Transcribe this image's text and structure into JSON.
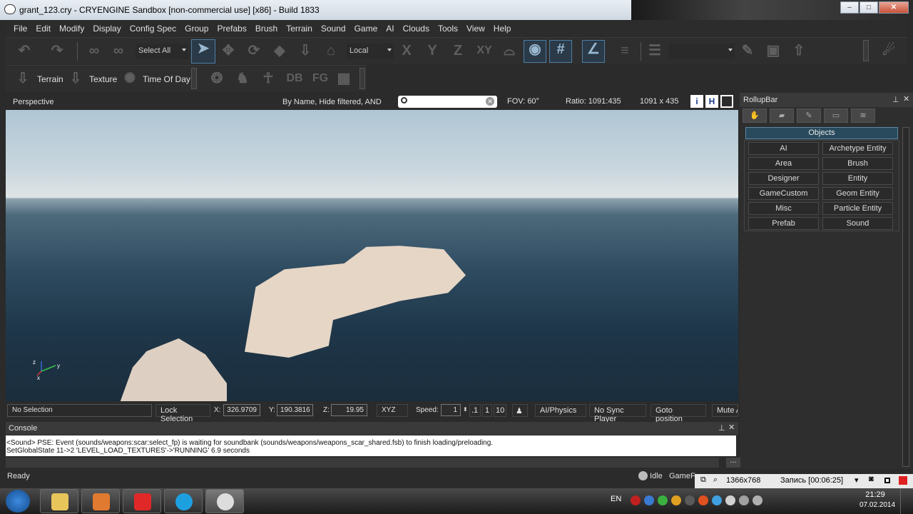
{
  "window": {
    "title": "grant_123.cry - CRYENGINE Sandbox [non-commercial use] [x86] - Build 1833",
    "controls": [
      "–",
      "□",
      "✕"
    ]
  },
  "menu": [
    "File",
    "Edit",
    "Modify",
    "Display",
    "Config Spec",
    "Group",
    "Prefabs",
    "Brush",
    "Terrain",
    "Sound",
    "Game",
    "AI",
    "Clouds",
    "Tools",
    "View",
    "Help"
  ],
  "toolbar": {
    "selection_mode": "Select All",
    "coord_system": "Local",
    "axis_x": "X",
    "axis_y": "Y",
    "axis_z": "Z",
    "axis_xy": "XY",
    "terrain_label": "Terrain",
    "texture_label": "Texture",
    "time_of_day_label": "Time Of Day",
    "db_label": "DB",
    "fg_label": "FG"
  },
  "viewport": {
    "title": "Perspective",
    "filter_text": "By Name, Hide filtered, AND",
    "search_value": "",
    "fov": "FOV:   60°",
    "ratio": "Ratio:  1091:435",
    "resolution": "1091 x 435",
    "btn_i": "i",
    "btn_h": "H",
    "axis_labels": {
      "z": "z",
      "y": "y",
      "x": "x"
    }
  },
  "rollup": {
    "title": "RollupBar",
    "section": "Objects",
    "buttons": [
      "AI",
      "Archetype Entity",
      "Area",
      "Brush",
      "Designer",
      "Entity",
      "GameCustom",
      "Geom Entity",
      "Misc",
      "Particle Entity",
      "Prefab",
      "Sound"
    ]
  },
  "status_row": {
    "selection": "No Selection",
    "lock_selection": "Lock Selection",
    "x_label": "X:",
    "x_value": "326.9709",
    "y_label": "Y:",
    "y_value": "190.3816",
    "z_label": "Z:",
    "z_value": "19.95",
    "xyz": "XYZ",
    "speed_label": "Speed:",
    "speed_value": "1",
    "speed_01": ".1",
    "speed_1": "1",
    "speed_10": "10",
    "ai_physics": "AI/Physics",
    "no_sync": "No Sync Player",
    "goto": "Goto position",
    "mute": "Mute A"
  },
  "console": {
    "title": "Console",
    "lines": [
      "<Sound> PSE: Event (sounds/weapons:scar:select_fp) is waiting for soundbank (sounds/weapons/weapons_scar_shared.fsb) to finish loading/preloading.",
      "SetGlobalState 11->2 'LEVEL_LOAD_TEXTURES'->'RUNNING' 6.9 seconds"
    ],
    "more": "..."
  },
  "statusbar": {
    "ready": "Ready",
    "idle": "Idle",
    "game_folder": "GameF"
  },
  "recorder": {
    "resolution": "1366x768",
    "recording": "Запись [00:06:25]"
  },
  "taskbar": {
    "lang": "EN",
    "time": "21:29",
    "date": "07.02.2014"
  },
  "colors": {
    "accent": "#4e7fa5",
    "objects_header": "#284a5c"
  }
}
